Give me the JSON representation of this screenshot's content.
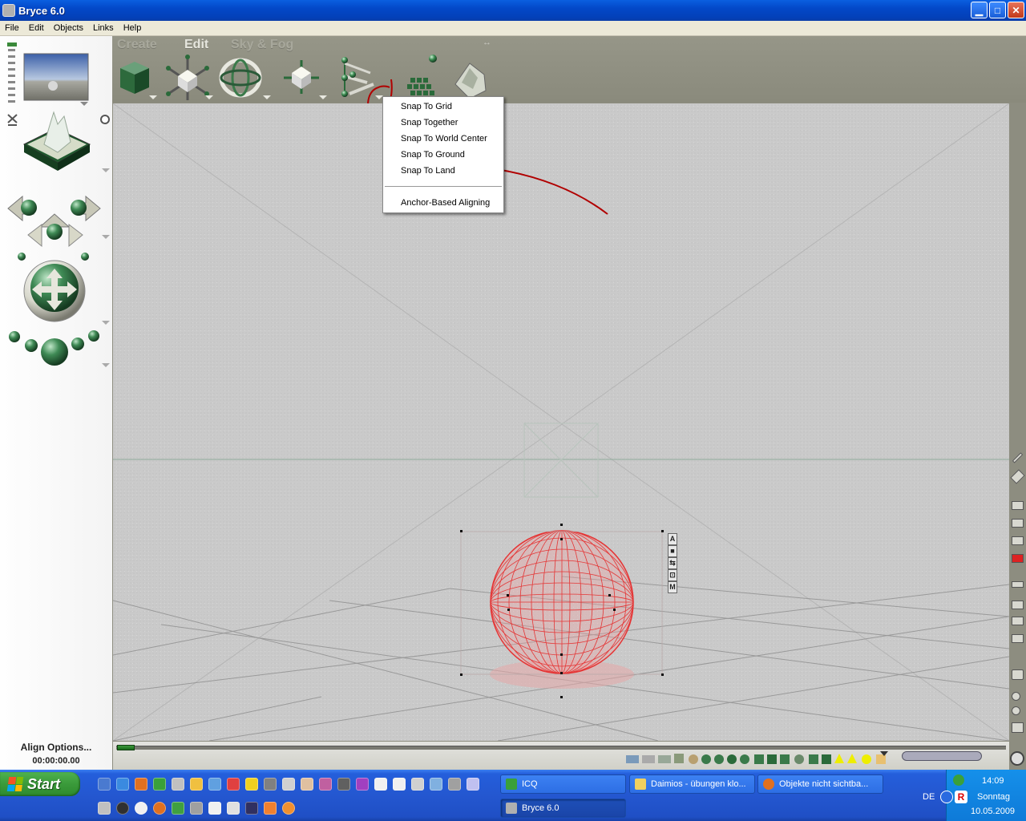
{
  "window": {
    "title": "Bryce 6.0",
    "min_label": "▁",
    "max_label": "□",
    "close_label": "✕"
  },
  "menubar": [
    "File",
    "Edit",
    "Objects",
    "Links",
    "Help"
  ],
  "tabs": {
    "create": "Create",
    "edit": "Edit",
    "sky_fog": "Sky & Fog"
  },
  "context_menu": {
    "items": [
      "Snap To Grid",
      "Snap Together",
      "Snap To World Center",
      "Snap To Ground",
      "Snap To Land"
    ],
    "extra": "Anchor-Based Aligning"
  },
  "sphere_handles": [
    "A",
    "■",
    "⇆",
    "⊡",
    "M"
  ],
  "status": {
    "align_options": "Align Options...",
    "time": "00:00:00.00"
  },
  "taskbar": {
    "start": "Start",
    "buttons": [
      {
        "label": "ICQ"
      },
      {
        "label": "Daimios - übungen klo..."
      },
      {
        "label": "Objekte nicht sichtba..."
      },
      {
        "label": "Bryce 6.0"
      }
    ],
    "tray": {
      "lang": "DE",
      "time": "14:09",
      "day": "Sonntag",
      "date": "10.05.2009"
    }
  },
  "colors": {
    "wireframe": "#e53535",
    "annotation": "#b10000",
    "titlebar": "#0348c8",
    "taskbar": "#245edb"
  }
}
